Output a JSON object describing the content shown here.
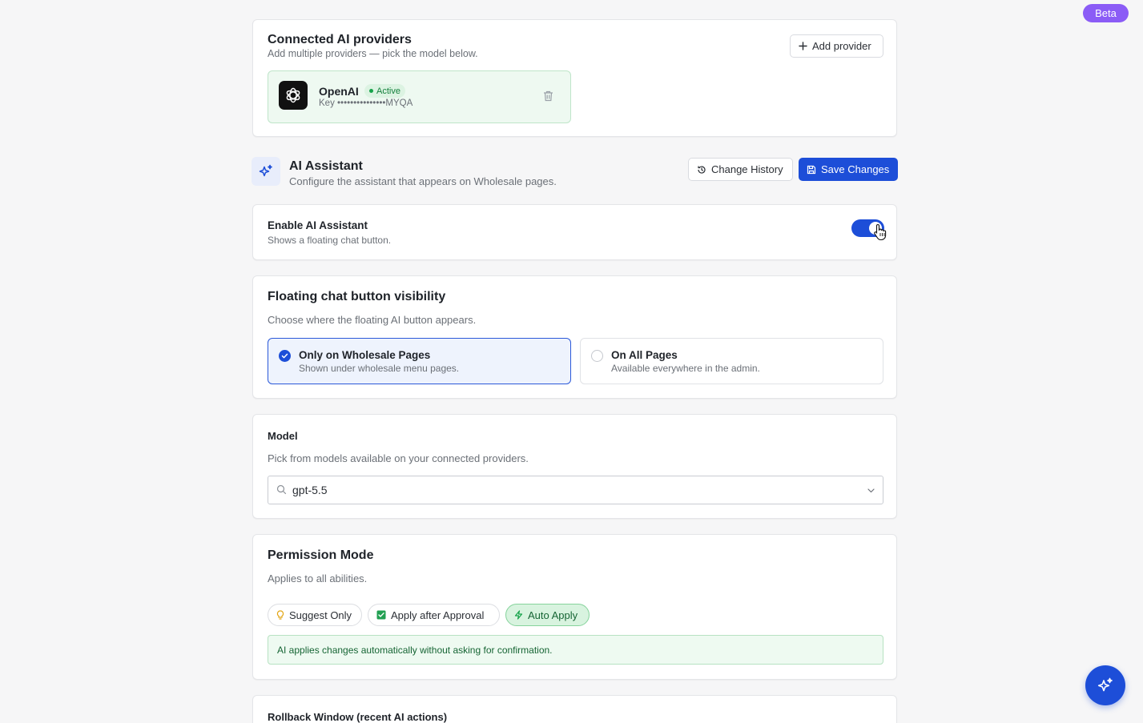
{
  "badge": {
    "label": "Beta"
  },
  "providers": {
    "title": "Connected AI providers",
    "subtitle": "Add multiple providers — pick the model below.",
    "add_label": "Add provider",
    "items": [
      {
        "name": "OpenAI",
        "status": "Active",
        "key": "Key •••••••••••••••MYQA"
      }
    ]
  },
  "assistant": {
    "title": "AI Assistant",
    "subtitle": "Configure the assistant that appears on Wholesale pages.",
    "history_label": "Change History",
    "save_label": "Save Changes"
  },
  "enable": {
    "title": "Enable AI Assistant",
    "subtitle": "Shows a floating chat button.",
    "enabled": true
  },
  "visibility": {
    "title": "Floating chat button visibility",
    "subtitle": "Choose where the floating AI button appears.",
    "options": [
      {
        "label": "Only on Wholesale Pages",
        "desc": "Shown under wholesale menu pages.",
        "selected": true
      },
      {
        "label": "On All Pages",
        "desc": "Available everywhere in the admin.",
        "selected": false
      }
    ]
  },
  "model": {
    "title": "Model",
    "subtitle": "Pick from models available on your connected providers.",
    "value": "gpt-5.5"
  },
  "permission": {
    "title": "Permission Mode",
    "subtitle": "Applies to all abilities.",
    "modes": [
      {
        "label": "Suggest Only",
        "icon": "lightbulb-icon"
      },
      {
        "label": "Apply after Approval",
        "icon": "checkbox-icon"
      },
      {
        "label": "Auto Apply",
        "icon": "lightning-icon",
        "active": true
      }
    ],
    "info": "AI applies changes automatically without asking for confirmation."
  },
  "rollback": {
    "title": "Rollback Window (recent AI actions)"
  },
  "colors": {
    "primary": "#1d4ed8",
    "success": "#16a34a",
    "beta": "#8b5cf6"
  }
}
